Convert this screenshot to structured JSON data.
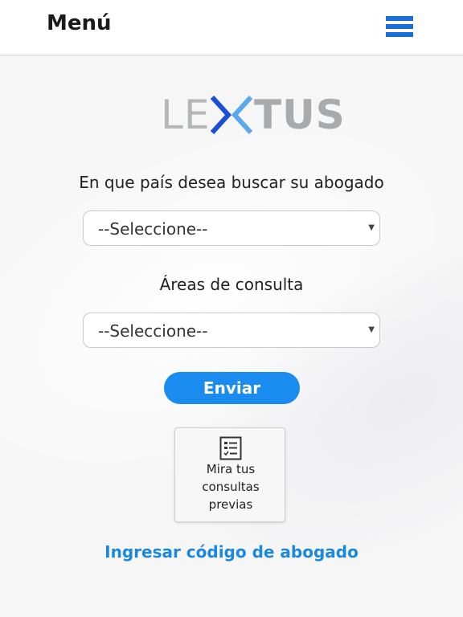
{
  "header": {
    "title": "Menú"
  },
  "logo": {
    "text_left": "LE",
    "text_right": "TUS"
  },
  "form": {
    "country_label": "En que país desea buscar su abogado",
    "country_select_value": "--Seleccione--",
    "area_label": "Áreas de consulta",
    "area_select_value": "--Seleccione--",
    "submit_label": "Enviar"
  },
  "previous": {
    "line1": "Mira tus",
    "line2": "consultas",
    "line3": "previas"
  },
  "lawyer_link": "Ingresar código de abogado",
  "colors": {
    "accent": "#1a8cf0",
    "menu_icon": "#1a6fd6",
    "link": "#1a88e0",
    "logo_x_dark": "#1a4fd6",
    "logo_x_light": "#5aa8ee"
  }
}
